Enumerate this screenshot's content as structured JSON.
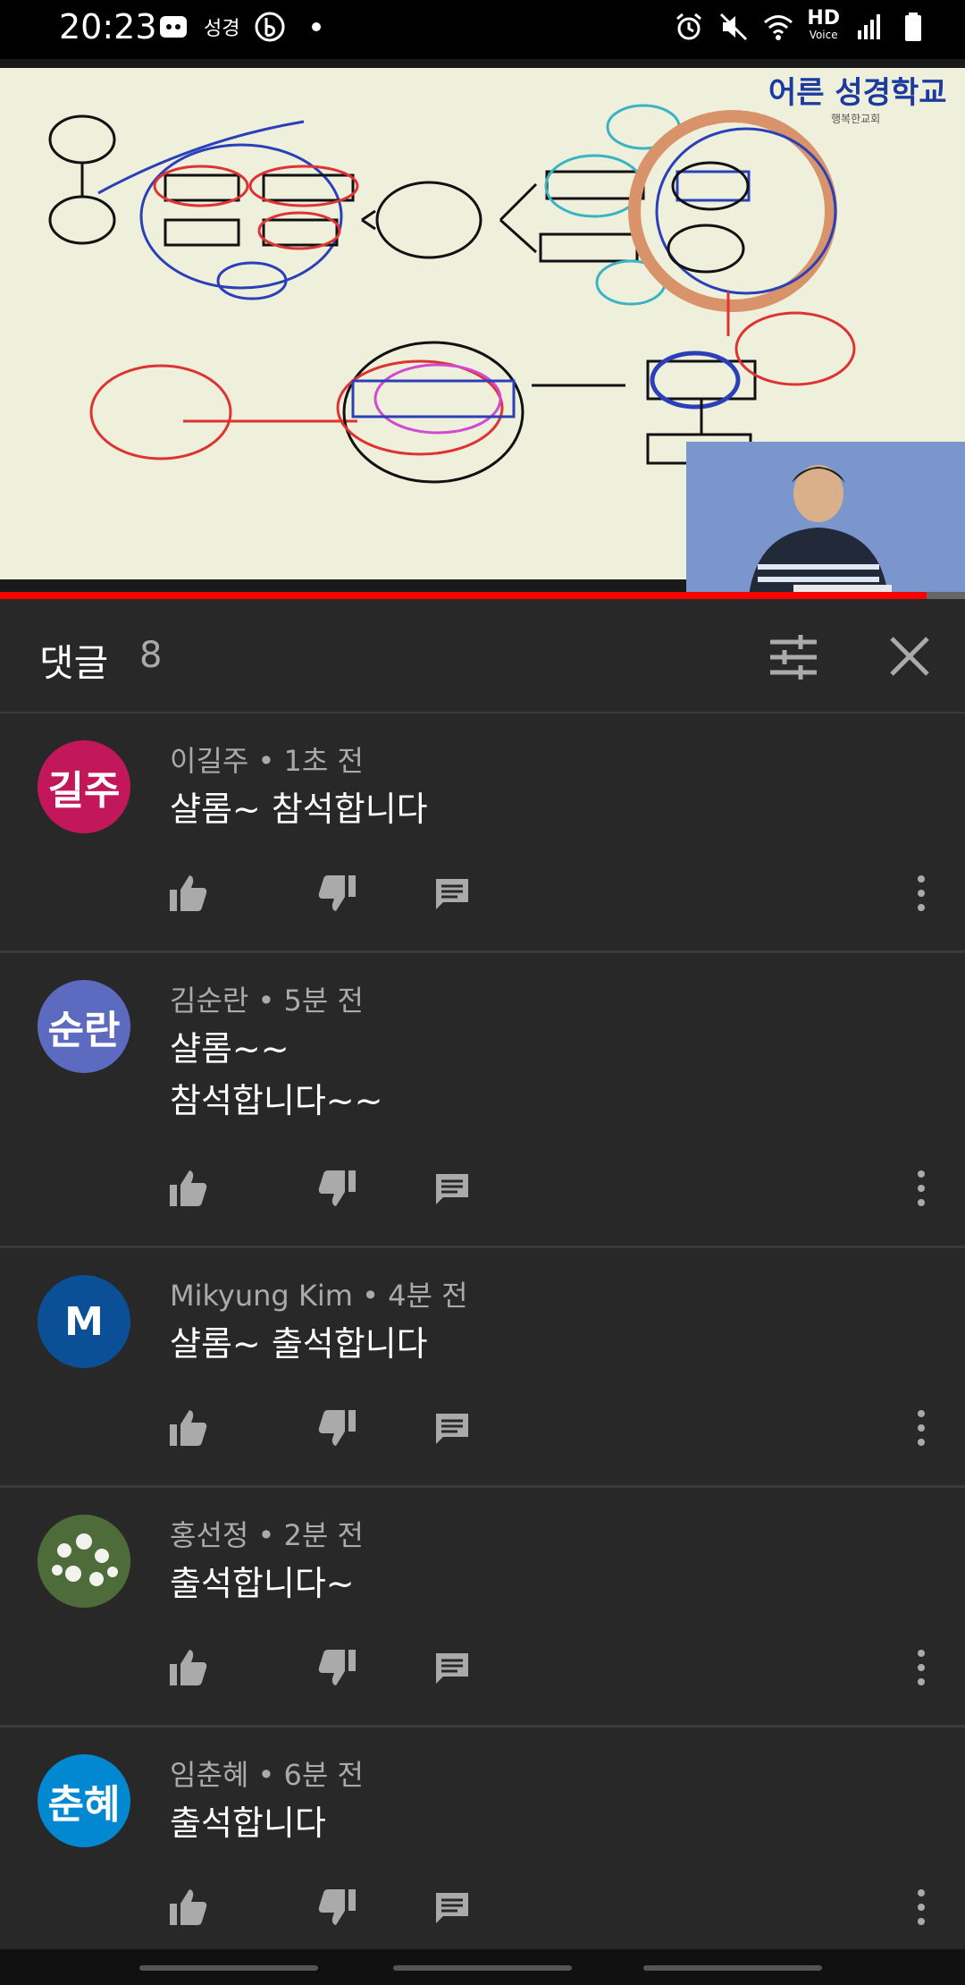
{
  "status_bar": {
    "time": "20:23",
    "notification_text": "성경",
    "hd_label": "HD",
    "hd_sub": "Voice",
    "icons": [
      "discord-icon",
      "b-app-icon",
      "dot-icon",
      "alarm-icon",
      "mute-icon",
      "wifi-icon",
      "signal-icon",
      "battery-icon"
    ]
  },
  "video": {
    "logo_title": "어른 성경학교",
    "logo_sub": "행복한교회",
    "progress": 0.96
  },
  "comments_header": {
    "title": "댓글",
    "count": "8"
  },
  "comments": [
    {
      "initials": "길주",
      "avatar_color": "#c2185b",
      "author": "이길주",
      "time": "1초 전",
      "text": "샬롬~ 참석합니다"
    },
    {
      "initials": "순란",
      "avatar_color": "#5c6bc0",
      "author": "김순란",
      "time": "5분 전",
      "text": "샬롬~~\n참석합니다~~"
    },
    {
      "initials": "M",
      "avatar_color": "#0b4f96",
      "author": "Mikyung Kim",
      "time": "4분 전",
      "text": "샬롬~ 출석합니다"
    },
    {
      "initials": "",
      "avatar_color": "#4e6b3a",
      "author": "홍선정",
      "time": "2분 전",
      "text": "출석합니다~"
    },
    {
      "initials": "춘혜",
      "avatar_color": "#0288d1",
      "author": "임춘혜",
      "time": "6분 전",
      "text": "출석합니다"
    }
  ]
}
